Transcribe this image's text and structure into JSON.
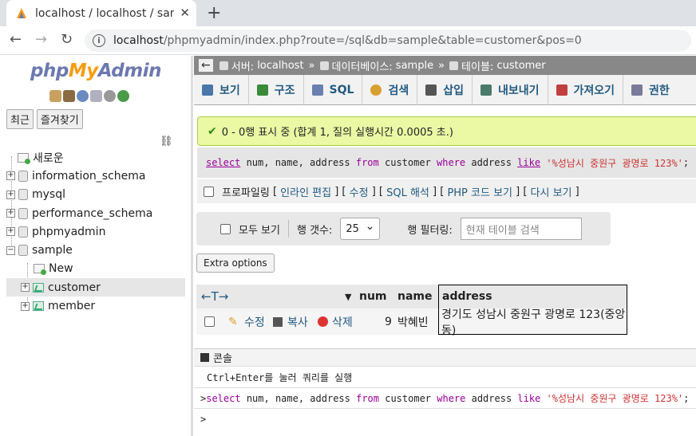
{
  "browser": {
    "tab_title": "localhost / localhost / sample",
    "close_glyph": "✕",
    "new_tab_glyph": "+",
    "url_host": "localhost",
    "url_path": "/phpmyadmin/index.php?route=/sql&db=sample&table=customer&pos=0",
    "back_glyph": "←",
    "forward_glyph": "→",
    "reload_glyph": "↻",
    "info_glyph": "i"
  },
  "sidebar": {
    "logo_php": "php",
    "logo_my": "My",
    "logo_admin": "Admin",
    "recent_label": "최근",
    "favorites_label": "즐겨찾기",
    "link_glyph": "⛓",
    "tree": [
      {
        "label": "새로운",
        "type": "new",
        "expander": ""
      },
      {
        "label": "information_schema",
        "type": "db",
        "expander": "+"
      },
      {
        "label": "mysql",
        "type": "db",
        "expander": "+"
      },
      {
        "label": "performance_schema",
        "type": "db",
        "expander": "+"
      },
      {
        "label": "phpmyadmin",
        "type": "db",
        "expander": "+"
      },
      {
        "label": "sample",
        "type": "db",
        "expander": "−"
      },
      {
        "label": "New",
        "type": "new-child",
        "expander": ""
      },
      {
        "label": "customer",
        "type": "table",
        "expander": "+"
      },
      {
        "label": "member",
        "type": "table",
        "expander": "+"
      }
    ]
  },
  "breadcrumb": {
    "back_glyph": "←",
    "server_label": "서버:",
    "server": "localhost",
    "db_label": "데이터베이스:",
    "db": "sample",
    "table_label": "테이블:",
    "table": "customer",
    "sep": "»"
  },
  "menu": [
    {
      "label": "보기",
      "color": "#4a76a8"
    },
    {
      "label": "구조",
      "color": "#3a8a3a"
    },
    {
      "label": "SQL",
      "color": "#6a7fb0"
    },
    {
      "label": "검색",
      "color": "#d8a030"
    },
    {
      "label": "삽입",
      "color": "#333"
    },
    {
      "label": "내보내기",
      "color": "#4a7a6a"
    },
    {
      "label": "가져오기",
      "color": "#c04040"
    },
    {
      "label": "권한",
      "color": "#7a7a9a"
    }
  ],
  "success": {
    "check_glyph": "✔",
    "message": "0 - 0행 표시 중 (합계 1, 질의 실행시간 0.0005 초.)"
  },
  "sql": {
    "kw_select": "select",
    "cols": " num, name, address ",
    "kw_from": "from",
    "table": " customer ",
    "kw_where": "where",
    "col": " address ",
    "kw_like": "like",
    "value": " '%성남시 중원구 광명로 123%'",
    "end": ";"
  },
  "profiling": {
    "label": "프로파일링",
    "links": [
      "인라인 편집",
      "수정",
      "SQL 해석",
      "PHP 코드 보기",
      "다시 보기"
    ]
  },
  "controls": {
    "show_all": "모두 보기",
    "row_count_label": "행 갯수:",
    "row_count": "25",
    "filter_label": "행 필터링:",
    "filter_placeholder": "현재 테이블 검색"
  },
  "extra_options": "Extra options",
  "result": {
    "arrows": "←T→",
    "sort_glyph": "▼",
    "columns": [
      "num",
      "name",
      "address"
    ],
    "row": {
      "edit": "수정",
      "copy": "복사",
      "delete": "삭제",
      "num": "9",
      "name": "박혜빈",
      "address": "경기도 성남시 중원구 광명로 123(중앙동)"
    }
  },
  "console": {
    "title": "콘솔",
    "hint": "Ctrl+Enter를 눌러 쿼리를 실행",
    "prompt": ">",
    "history_prefix": "select",
    "history_rest_a": " num, name, address ",
    "history_from": "from",
    "history_rest_b": " customer ",
    "history_where": "where",
    "history_rest_c": " address ",
    "history_like": "like",
    "history_value": " '%성남시 중원구 광명로 123%'",
    "history_end": ";"
  }
}
